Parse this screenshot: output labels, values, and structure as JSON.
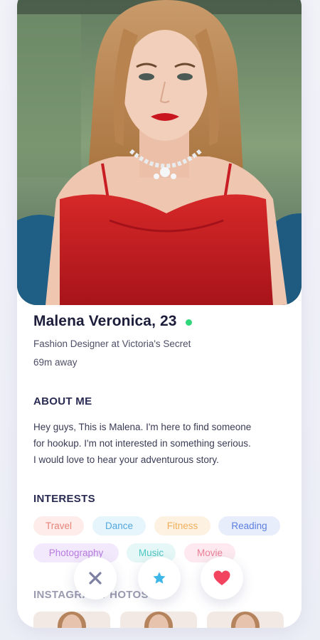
{
  "profile": {
    "name": "Malena Veronica, 23",
    "online": true,
    "job": "Fashion Designer at Victoria's Secret",
    "distance": "69m away",
    "photo_icon": "profile-photo"
  },
  "about": {
    "title": "ABOUT ME",
    "lines": [
      "Hey guys, This is Malena. I'm here to find someone",
      "for hookup. I'm not interested in something serious.",
      "I would love to hear your adventurous story."
    ]
  },
  "interests": {
    "title": "INTERESTS",
    "tags": [
      {
        "label": "Travel",
        "color": "#e8837a",
        "bg": "#fdece9"
      },
      {
        "label": "Dance",
        "color": "#52a8df",
        "bg": "#e6f4fc"
      },
      {
        "label": "Fitness",
        "color": "#f0ae5c",
        "bg": "#fdf2e2"
      },
      {
        "label": "Reading",
        "color": "#5b7ee0",
        "bg": "#e8edfc"
      },
      {
        "label": "Photography",
        "color": "#b77be0",
        "bg": "#f3e9fc"
      },
      {
        "label": "Music",
        "color": "#4ec7c4",
        "bg": "#e5f8f7"
      },
      {
        "label": "Movie",
        "color": "#ea7f97",
        "bg": "#fde9ef"
      }
    ]
  },
  "instagram": {
    "title": "INSTAGRAM PHOTOS"
  },
  "actions": {
    "dislike_icon": "close-icon",
    "superlike_icon": "star-icon",
    "like_icon": "heart-icon",
    "dislike_color": "#7d7fa3",
    "superlike_color": "#3db7e8",
    "like_color": "#f2445f"
  },
  "colors": {
    "online": "#2fd67a",
    "title": "#1c1d3a",
    "section": "#2a2b52"
  }
}
